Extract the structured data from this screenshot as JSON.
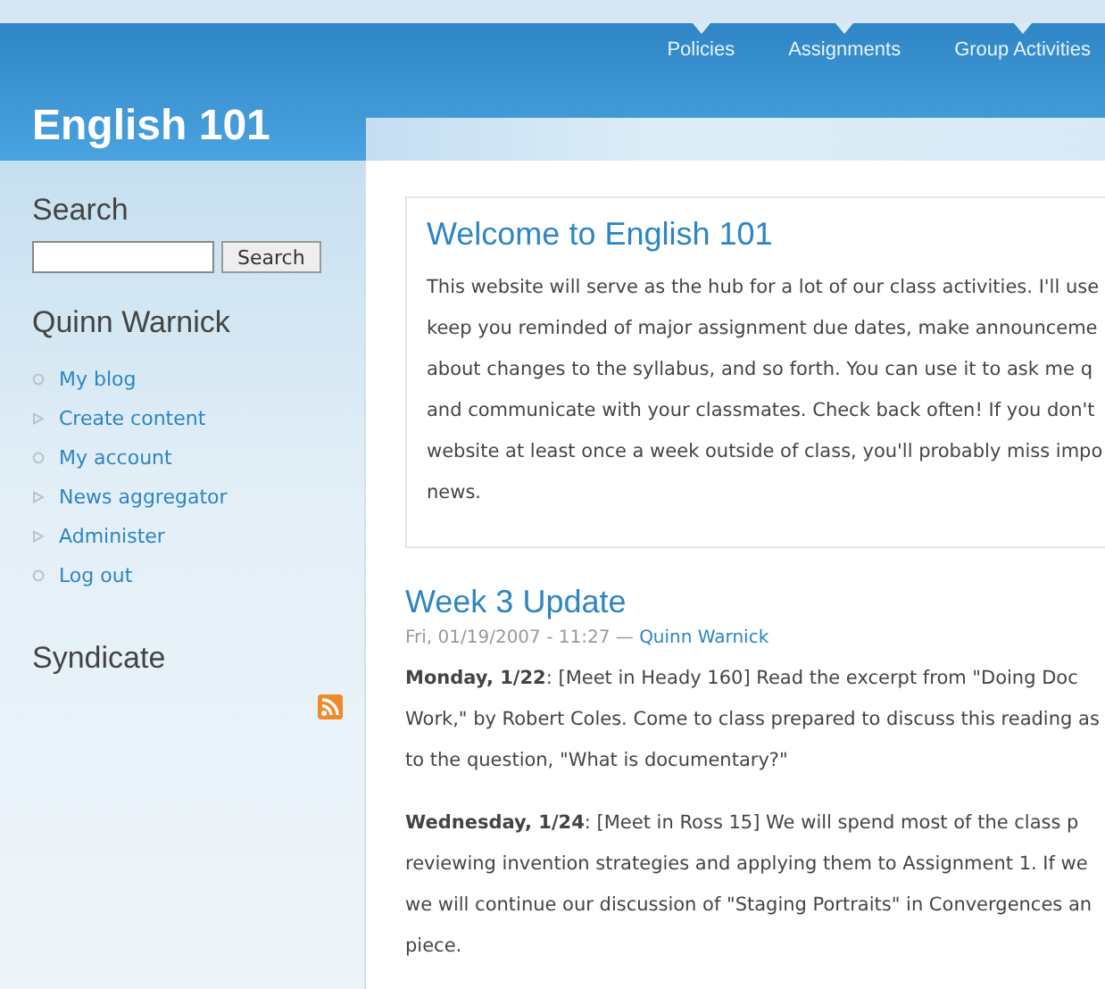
{
  "site_title": "English 101",
  "nav": [
    {
      "label": "Policies"
    },
    {
      "label": "Assignments"
    },
    {
      "label": "Group Activities"
    }
  ],
  "sidebar": {
    "search": {
      "heading": "Search",
      "button": "Search"
    },
    "user": {
      "heading": "Quinn Warnick",
      "items": [
        {
          "label": "My blog",
          "kind": "leaf"
        },
        {
          "label": "Create content",
          "kind": "collapsed"
        },
        {
          "label": "My account",
          "kind": "leaf"
        },
        {
          "label": "News aggregator",
          "kind": "collapsed"
        },
        {
          "label": "Administer",
          "kind": "collapsed"
        },
        {
          "label": "Log out",
          "kind": "leaf"
        }
      ]
    },
    "syndicate": {
      "heading": "Syndicate"
    }
  },
  "welcome": {
    "title": "Welcome to English 101",
    "lines": [
      "This website will serve as the hub for a lot of our class activities. I'll use",
      "keep you reminded of major assignment due dates, make announceme",
      "about changes to the syllabus, and so forth. You can use it to ask me q",
      "and communicate with your classmates. Check back often! If you don't",
      "website at least once a week outside of class, you'll probably miss impo",
      "news."
    ]
  },
  "post": {
    "title": "Week 3 Update",
    "date": "Fri, 01/19/2007 - 11:27 —",
    "author": "Quinn Warnick",
    "paragraphs": [
      [
        "**Monday, 1/22**: [Meet in Heady 160] Read the excerpt from \"Doing Doc",
        "Work,\" by Robert Coles. Come to class prepared to discuss this reading as",
        "to the question, \"What is documentary?\""
      ],
      [
        "**Wednesday, 1/24**: [Meet in Ross 15] We will spend most of the class p",
        "reviewing invention strategies and applying them to Assignment 1. If we",
        "we will continue our discussion of \"Staging Portraits\" in Convergences an",
        "piece."
      ]
    ]
  }
}
